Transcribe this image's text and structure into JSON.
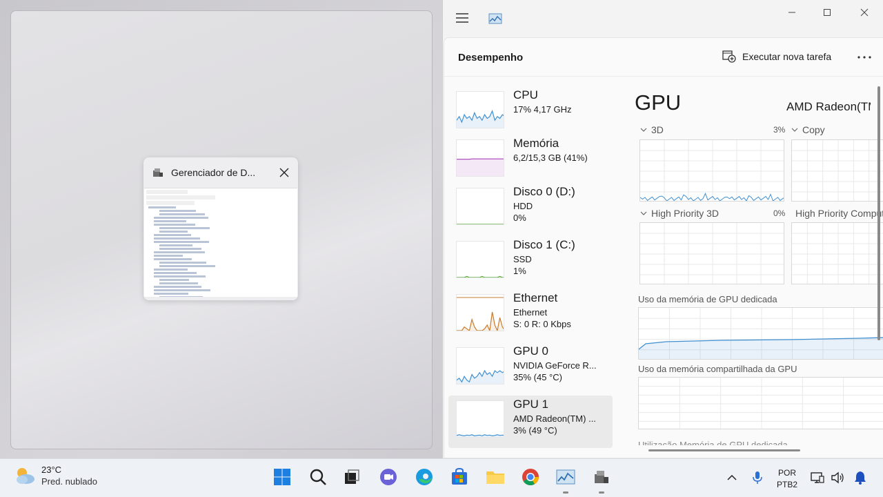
{
  "thumbnail": {
    "title": "Gerenciador de D...",
    "preview_lines": 28
  },
  "taskmgr": {
    "page_title": "Desempenho",
    "new_task_label": "Executar nova tarefa",
    "items": [
      {
        "name": "CPU",
        "line1": "17% 4,17 GHz",
        "line2": ""
      },
      {
        "name": "Memória",
        "line1": "6,2/15,3 GB (41%)",
        "line2": ""
      },
      {
        "name": "Disco 0 (D:)",
        "line1": "HDD",
        "line2": "0%"
      },
      {
        "name": "Disco 1 (C:)",
        "line1": "SSD",
        "line2": "1%"
      },
      {
        "name": "Ethernet",
        "line1": "Ethernet",
        "line2": "S: 0 R: 0 Kbps"
      },
      {
        "name": "GPU 0",
        "line1": "NVIDIA GeForce R...",
        "line2": "35% (45 °C)"
      },
      {
        "name": "GPU 1",
        "line1": "AMD Radeon(TM) ...",
        "line2": "3% (49 °C)"
      }
    ],
    "selected_index": 6,
    "detail": {
      "title": "GPU",
      "model": "AMD Radeon(TM) Graphics",
      "engines": [
        {
          "label": "3D",
          "percent": "3%"
        },
        {
          "label": "Copy",
          "percent": ""
        },
        {
          "label": "High Priority 3D",
          "percent": "0%"
        },
        {
          "label": "High Priority Compute",
          "percent": ""
        }
      ],
      "dedicated_memory_label": "Uso da memória de GPU dedicada",
      "shared_memory_label": "Uso da memória compartilhada da GPU",
      "cut_off_text": "Utilização   Memória de GPU dedicada"
    }
  },
  "taskbar": {
    "weather_temp": "23°C",
    "weather_desc": "Pred. nublado",
    "lang_line1": "POR",
    "lang_line2": "PTB2",
    "apps": [
      "windows-start",
      "search",
      "task-view",
      "teams-chat",
      "edge",
      "microsoft-store",
      "file-explorer",
      "chrome",
      "task-manager",
      "device-manager"
    ]
  },
  "colors": {
    "cpu_graph": "#3f8fd1",
    "memory_graph": "#a53fb8",
    "ethernet_graph": "#c77b2c",
    "gpu_graph": "#3f8fd1",
    "disk_graph": "#52a833"
  }
}
